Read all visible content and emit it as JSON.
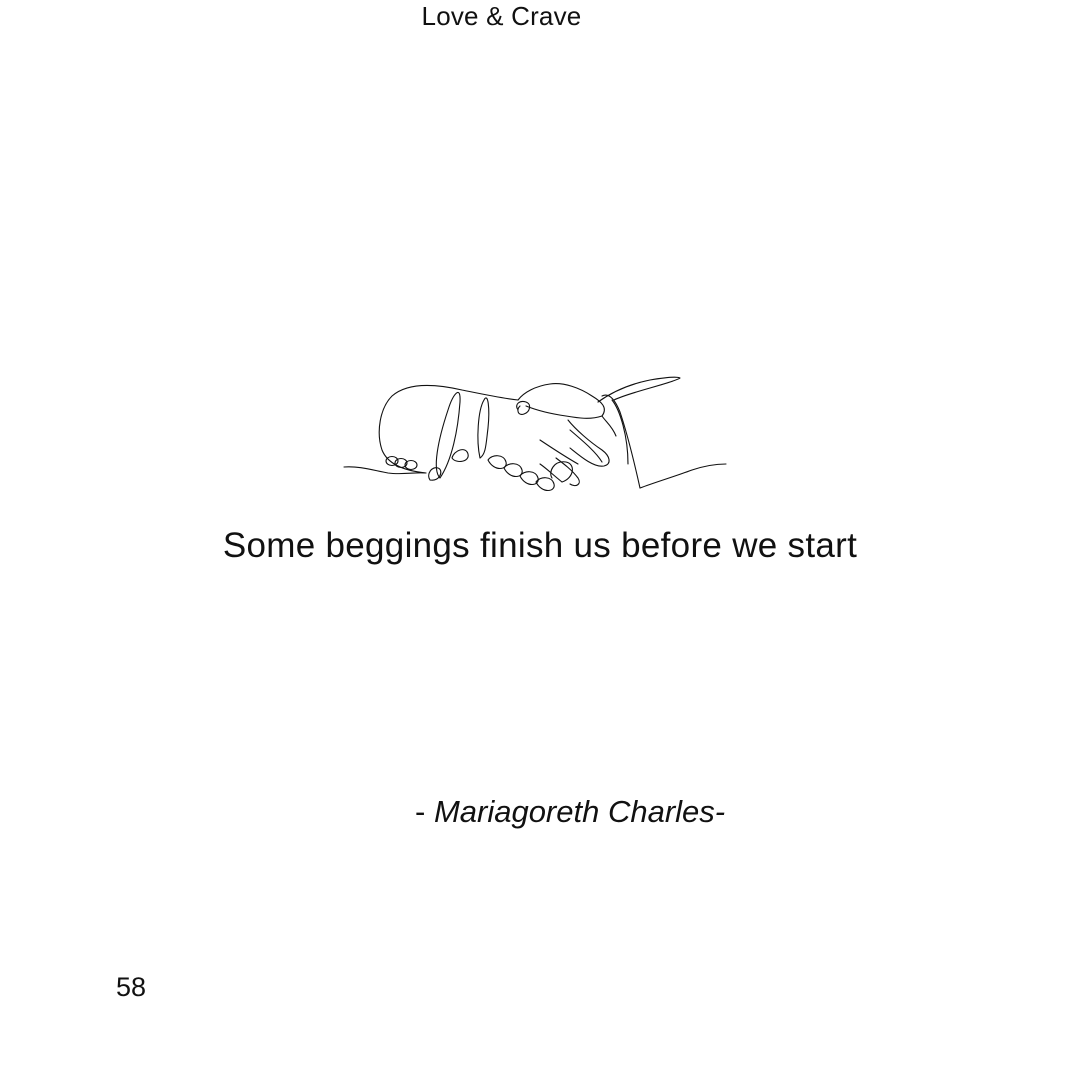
{
  "page": {
    "book_title": "Love & Crave",
    "illustration": "handshake-line-art",
    "quote": "Some beggings finish us before we start",
    "author_prefix": "- ",
    "author_name": "Mariagoreth Charles-",
    "page_number": "58"
  }
}
